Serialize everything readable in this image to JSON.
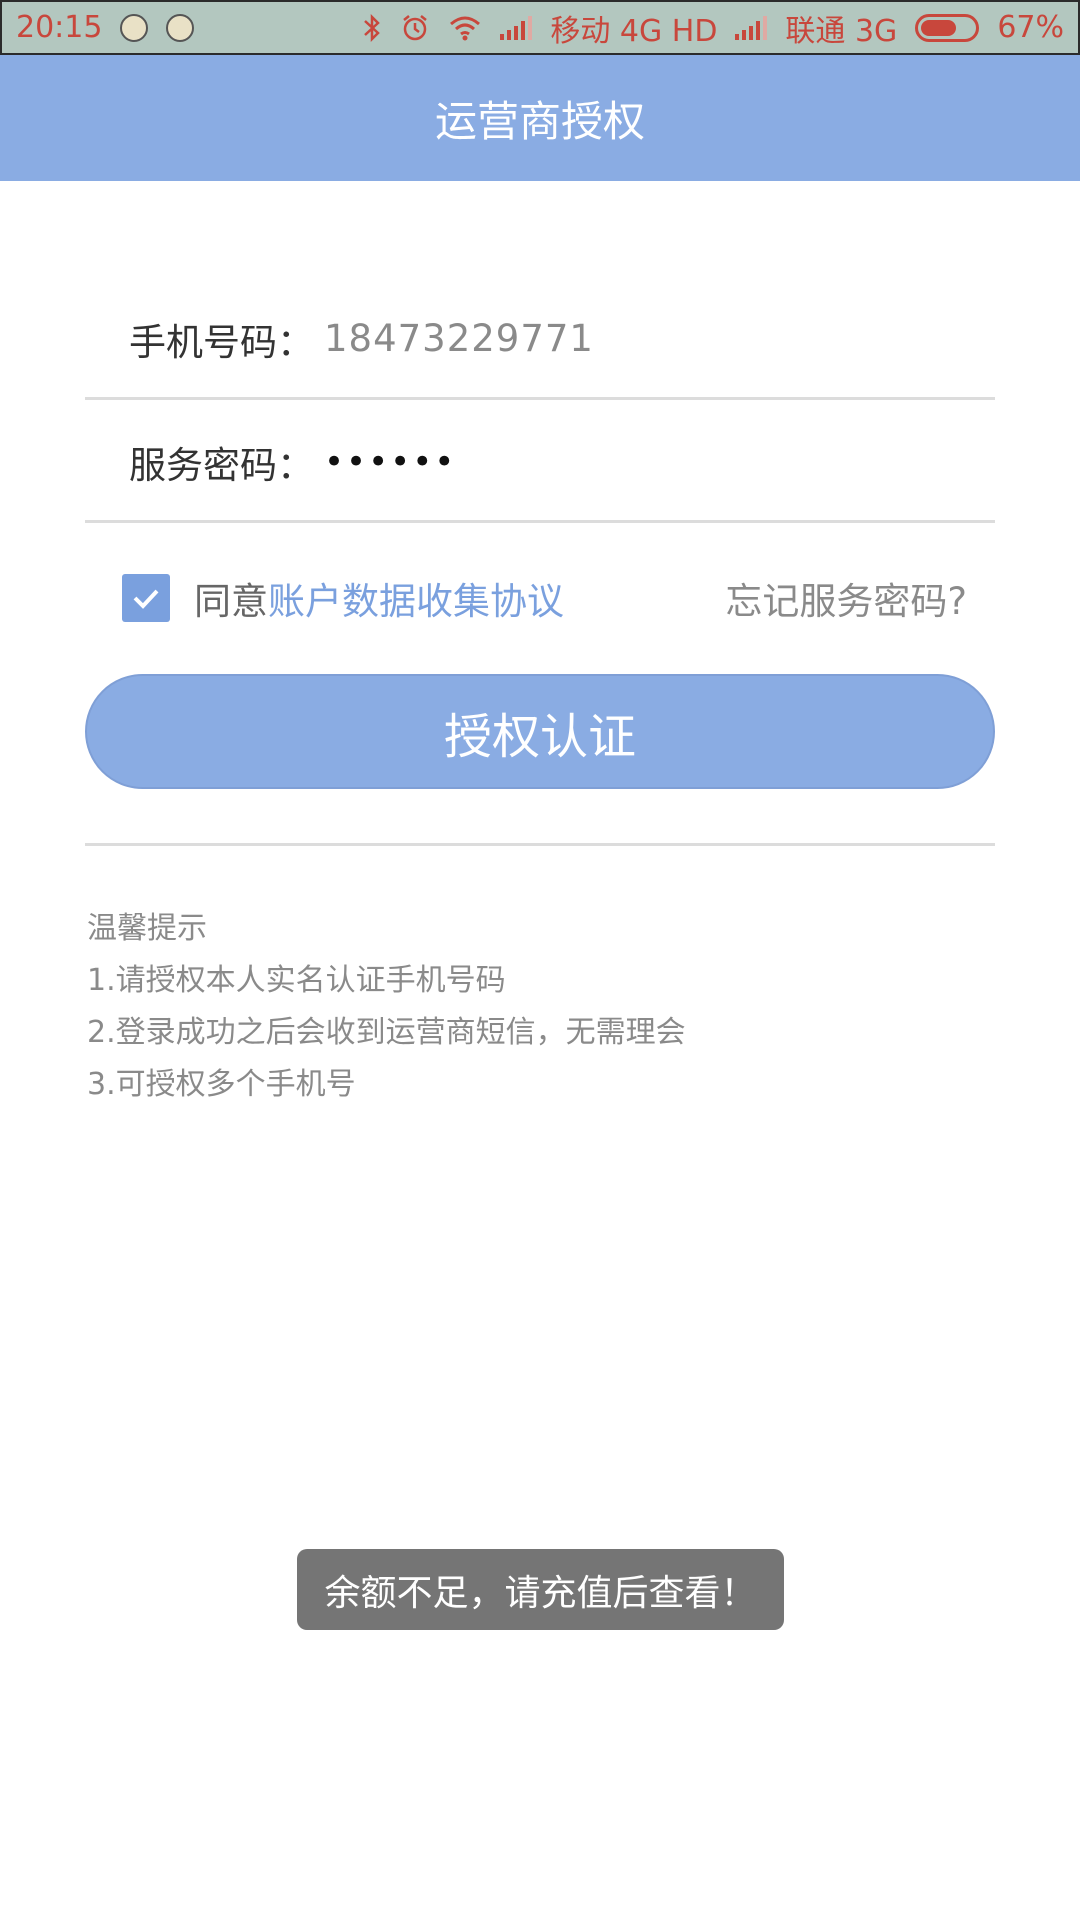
{
  "status_bar": {
    "time": "20:15",
    "carrier1": "移动",
    "net1": "4G HD",
    "carrier2": "联通",
    "net2": "3G",
    "battery_percent": "67%",
    "battery_level": 0.67,
    "icons": [
      "app-notification-icon",
      "app-notification-icon",
      "bluetooth-icon",
      "alarm-icon",
      "wifi-icon",
      "signal-icon",
      "signal-icon",
      "battery-icon"
    ]
  },
  "header": {
    "title": "运营商授权"
  },
  "form": {
    "phone_label": "手机号码：",
    "phone_value": "18473229771",
    "password_label": "服务密码：",
    "password_value": "••••••"
  },
  "agreement": {
    "checked": true,
    "prefix": "同意",
    "link": "账户数据收集协议",
    "forgot": "忘记服务密码?"
  },
  "button": {
    "label": "授权认证"
  },
  "tips": {
    "title": "温馨提示",
    "items": [
      "1.请授权本人实名认证手机号码",
      "2.登录成功之后会收到运营商短信，无需理会",
      "3.可授权多个手机号"
    ]
  },
  "toast": {
    "text": "余额不足，请充值后查看！"
  },
  "colors": {
    "primary": "#8aace3",
    "link": "#7aa0de",
    "status_text": "#c8473c",
    "toast_bg": "#757575"
  }
}
